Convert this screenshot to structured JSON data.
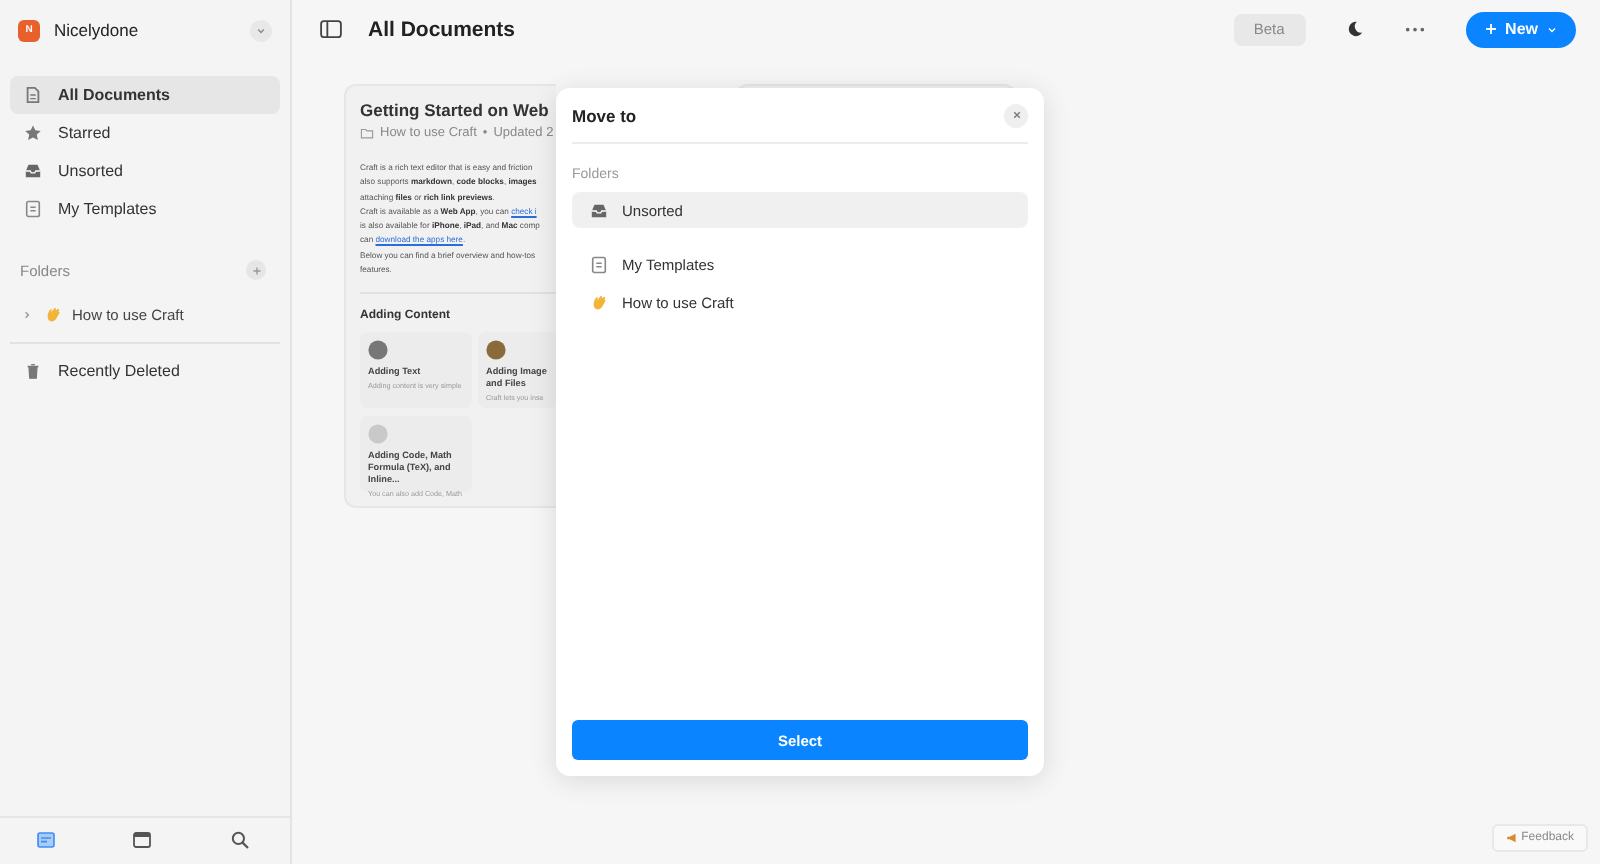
{
  "workspace": {
    "initial": "N",
    "name": "Nicelydone"
  },
  "sidebar": {
    "items": [
      {
        "kind": "doc",
        "label": "All Documents",
        "selected": true
      },
      {
        "kind": "star",
        "label": "Starred",
        "selected": false
      },
      {
        "kind": "inbox",
        "label": "Unsorted",
        "selected": false
      },
      {
        "kind": "template",
        "label": "My Templates",
        "selected": false
      }
    ],
    "folders_heading": "Folders",
    "folders": [
      {
        "kind": "hand",
        "label": "How to use Craft",
        "expanded": false
      }
    ],
    "trash": "Recently Deleted",
    "bottom_tabs": [
      {
        "kind": "docs",
        "selected": true
      },
      {
        "kind": "calendar",
        "selected": false
      },
      {
        "kind": "search",
        "selected": false
      }
    ]
  },
  "header": {
    "title": "All Documents",
    "beta": "Beta",
    "new_button": "New"
  },
  "document_card": {
    "title": "Getting Started on Web",
    "folder": "How to use Craft",
    "separator": "•",
    "updated": "Updated 2",
    "lines": [
      {
        "text": "Craft is a rich text editor that is easy and friction"
      },
      {
        "text": "also supports **markdown**, **code blocks**, **images**"
      },
      {
        "text": "attaching **files** or **rich link previews**."
      },
      {
        "text": "Craft is available as a **Web App**, you can ",
        "link": "check i"
      },
      {
        "text": "is also available for **iPhone**, **iPad**, and **Mac** comp"
      },
      {
        "text": "can ",
        "link": "download the apps here",
        "after": "."
      },
      {
        "text": "Below you can find a brief overview and how-tos"
      },
      {
        "text": "features."
      }
    ],
    "section": "Adding Content",
    "subcards": [
      {
        "kind": "text",
        "title": "Adding Text",
        "desc": "Adding content is very simple"
      },
      {
        "kind": "image",
        "title": "Adding Image and Files",
        "desc": "Craft lets you inse"
      },
      {
        "kind": "code",
        "title": "Adding Code, Math Formula (TeX), and Inline...",
        "desc": "You can also add Code, Math"
      }
    ]
  },
  "dialog": {
    "title": "Move to",
    "section": "Folders",
    "items": [
      {
        "kind": "inbox",
        "label": "Unsorted",
        "selected": true
      },
      {
        "kind": "template",
        "label": "My Templates",
        "selected": false
      },
      {
        "kind": "hand",
        "label": "How to use Craft",
        "selected": false
      }
    ],
    "button": "Select"
  },
  "feedback": "Feedback"
}
